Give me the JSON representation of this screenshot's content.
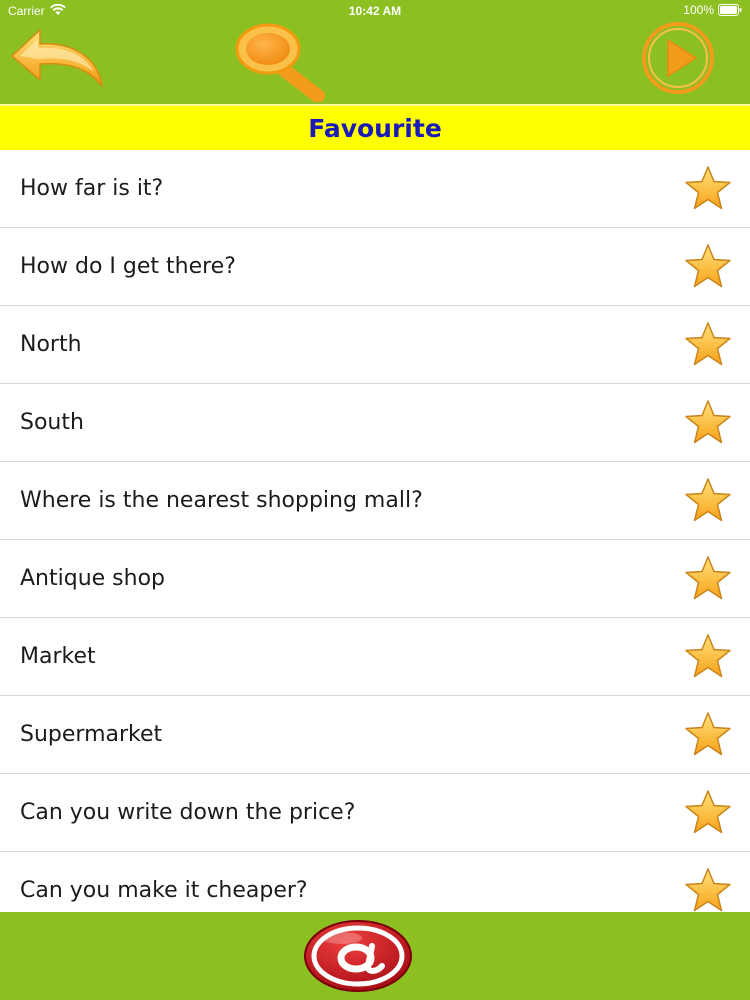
{
  "status_bar": {
    "carrier": "Carrier",
    "time": "10:42 AM",
    "battery": "100%"
  },
  "header": {
    "back_icon": "back-arrow-icon",
    "search_icon": "magnifier-icon",
    "play_icon": "play-icon"
  },
  "page": {
    "title": "Favourite"
  },
  "list": {
    "items": [
      {
        "label": "How far is it?"
      },
      {
        "label": "How do I get there?"
      },
      {
        "label": "North"
      },
      {
        "label": "South"
      },
      {
        "label": "Where is the nearest shopping mall?"
      },
      {
        "label": "Antique shop"
      },
      {
        "label": "Market"
      },
      {
        "label": "Supermarket"
      },
      {
        "label": "Can you write down the price?"
      },
      {
        "label": "Can you make it cheaper?"
      }
    ],
    "star_icon": "favourite-star-icon"
  },
  "footer": {
    "email_icon": "at-sign-icon"
  },
  "colors": {
    "header_green": "#8cc022",
    "title_yellow": "#ffff00",
    "title_text": "#1a1ab8",
    "icon_orange": "#f7a21a",
    "at_red": "#c8101a"
  }
}
